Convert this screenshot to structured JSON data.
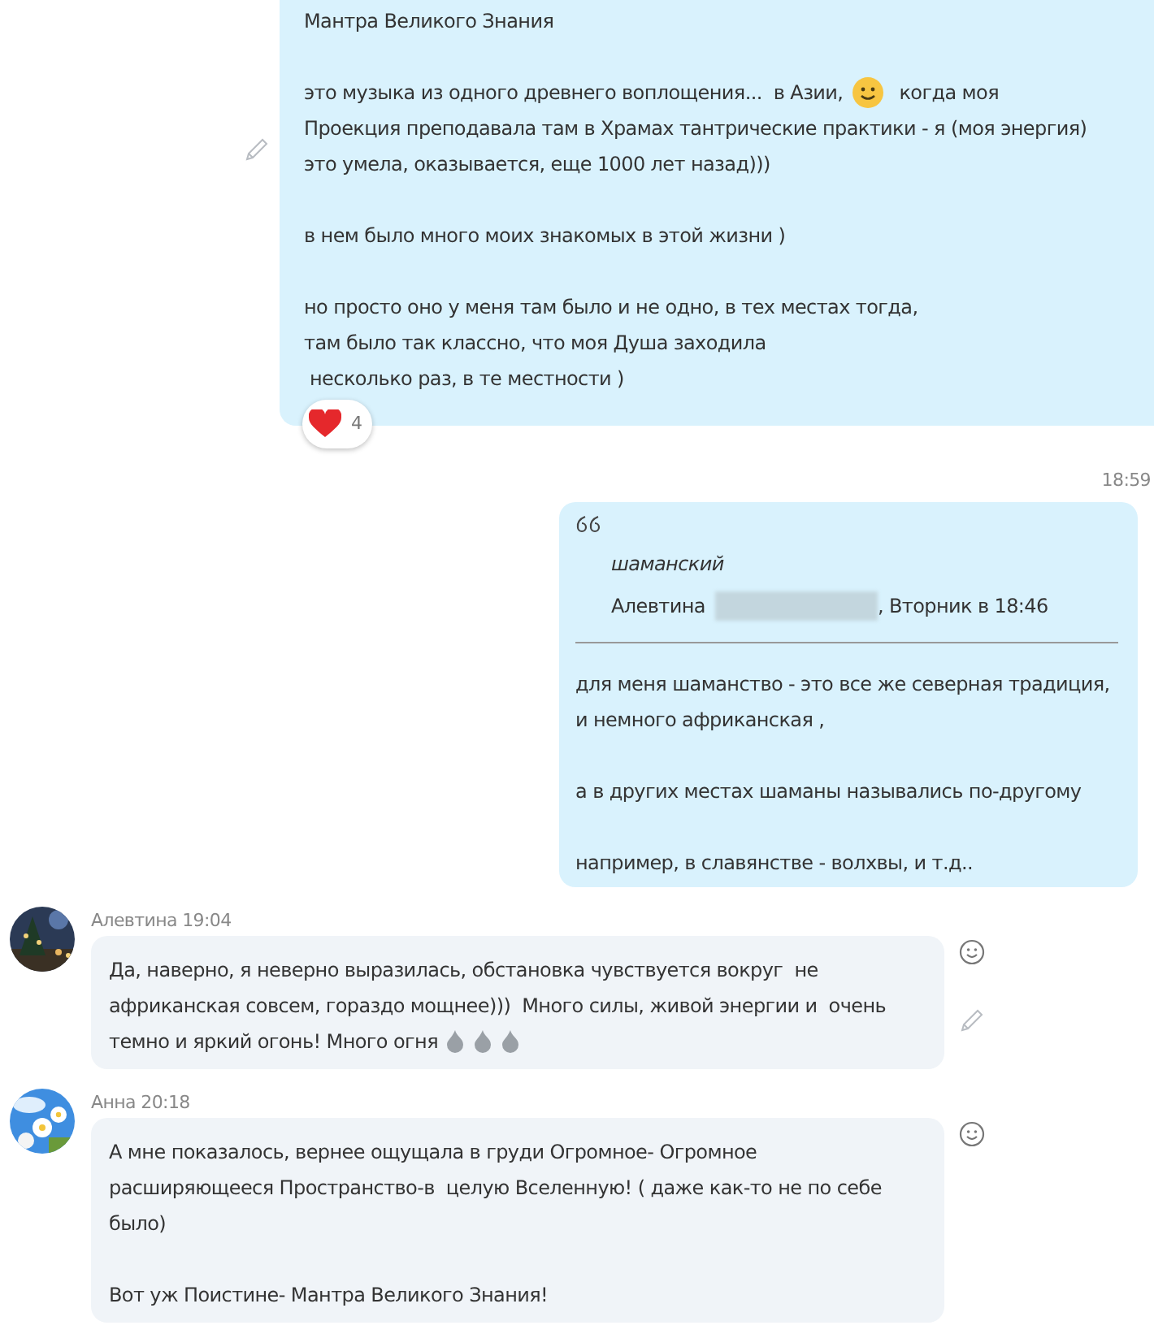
{
  "messages": [
    {
      "kind": "own",
      "edited": true,
      "paragraphs": [
        [
          "Мантра Великого Знания"
        ],
        [
          {
            "parts": [
              {
                "kind": "text",
                "text": "это музыка из одного древнего воплощения...  в Азии, "
              },
              {
                "kind": "smiley"
              },
              {
                "kind": "text",
                "text": "  когда моя"
              }
            ]
          },
          "Проекция преподавала там в Храмах тантрические практики - я (моя энергия)",
          "это умела, оказывается, еще 1000 лет назад)))"
        ],
        [
          "в нем было много моих знакомых в этой жизни )"
        ],
        [
          "но просто оно у меня там было и не одно, в тех местах тогда,",
          "там было так классно, что моя Душа заходила",
          " несколько раз, в те местности )"
        ]
      ],
      "reaction": {
        "kind": "heart",
        "count": "4"
      }
    },
    {
      "kind": "own_quote",
      "time": "18:59",
      "quote": {
        "title": "шаманский",
        "author": "Алевтина",
        "author_redacted": true,
        "date": ", Вторник в 18:46"
      },
      "paragraphs": [
        [
          "для меня шаманство - это все же северная традиция,",
          "и немного африканская ,"
        ],
        [
          "а в других местах шаманы назывались по-другому"
        ],
        [
          "например, в славянстве - волхвы, и т.д.."
        ]
      ]
    },
    {
      "kind": "incoming",
      "header": "Алевтина 19:04",
      "editable": true,
      "paragraphs": [
        [
          "Да, наверно, я неверно выразилась, обстановка чувствуется вокруг  не",
          "африканская совсем, гораздо мощнее)))  Много силы, живой энергии и  очень",
          {
            "parts": [
              {
                "kind": "text",
                "text": "темно и яркий огонь! Много огня"
              },
              {
                "kind": "flame"
              },
              {
                "kind": "flame"
              },
              {
                "kind": "flame"
              }
            ]
          }
        ]
      ]
    },
    {
      "kind": "incoming",
      "header": "Анна 20:18",
      "editable": false,
      "paragraphs": [
        [
          "А мне показалось, вернее ощущала в груди Огромное- Огромное",
          "расширяющееся Пространство-в  целую Вселенную! ( даже как-то не по себе",
          "было)"
        ],
        [
          "Вот уж Поистине- Мантра Великого Знания!"
        ]
      ]
    }
  ]
}
